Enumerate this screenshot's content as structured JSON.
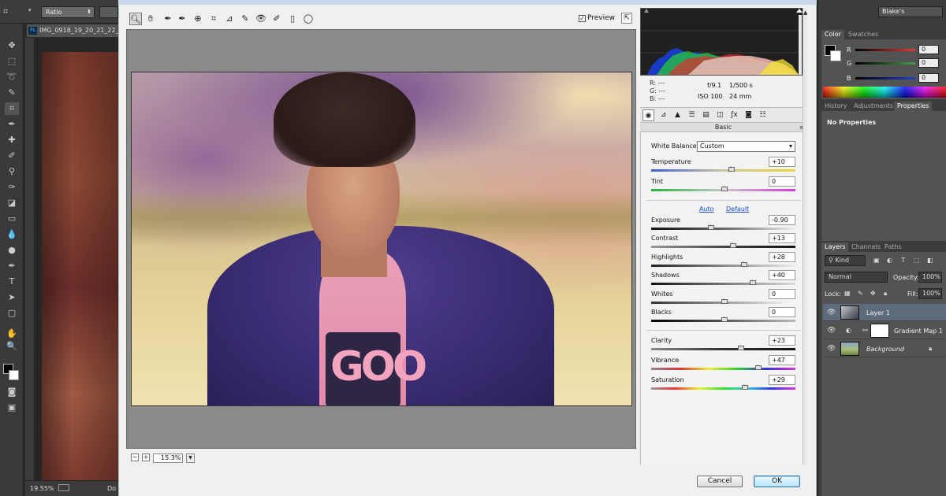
{
  "ps": {
    "options": {
      "ratio_label": "Ratio"
    },
    "doc_tab": "IMG_0918_19_20_21_22_t",
    "status": {
      "zoom": "19.55%",
      "doc_suffix": "Do"
    },
    "workspace": "Blake's"
  },
  "camera_raw": {
    "preview_label": "Preview",
    "preview_checked": true,
    "zoom_value": "15.3%",
    "readout": {
      "r": "R:",
      "g": "G:",
      "b": "B:",
      "dash": "---",
      "aperture": "f/9.1",
      "shutter": "1/500 s",
      "iso": "ISO 100",
      "focal": "24 mm"
    },
    "panel_title": "Basic",
    "white_balance": {
      "label": "White Balance:",
      "value": "Custom"
    },
    "auto_label": "Auto",
    "default_label": "Default",
    "sliders": {
      "temperature": {
        "label": "Temperature",
        "value": "+10",
        "level": 0.55
      },
      "tint": {
        "label": "Tint",
        "value": "0",
        "level": 0.5
      },
      "exposure": {
        "label": "Exposure",
        "value": "-0.90",
        "level": 0.41
      },
      "contrast": {
        "label": "Contrast",
        "value": "+13",
        "level": 0.565
      },
      "highlights": {
        "label": "Highlights",
        "value": "+28",
        "level": 0.64
      },
      "shadows": {
        "label": "Shadows",
        "value": "+40",
        "level": 0.7
      },
      "whites": {
        "label": "Whites",
        "value": "0",
        "level": 0.5
      },
      "blacks": {
        "label": "Blacks",
        "value": "0",
        "level": 0.5
      },
      "clarity": {
        "label": "Clarity",
        "value": "+23",
        "level": 0.615
      },
      "vibrance": {
        "label": "Vibrance",
        "value": "+47",
        "level": 0.735
      },
      "saturation": {
        "label": "Saturation",
        "value": "+29",
        "level": 0.645
      }
    },
    "buttons": {
      "cancel": "Cancel",
      "ok": "OK"
    },
    "photo_text": "GOO"
  },
  "color_panel": {
    "tabs": [
      "Color",
      "Swatches"
    ],
    "channels": [
      {
        "label": "R",
        "value": "0",
        "color": "#e53935"
      },
      {
        "label": "G",
        "value": "0",
        "color": "#43a047"
      },
      {
        "label": "B",
        "value": "0",
        "color": "#1e40c8"
      }
    ]
  },
  "props_panel": {
    "tabs": [
      "History",
      "Adjustments",
      "Properties"
    ],
    "empty_text": "No Properties"
  },
  "layers_panel": {
    "tabs": [
      "Layers",
      "Channels",
      "Paths"
    ],
    "kind_label": "Kind",
    "blend_mode": "Normal",
    "opacity_label": "Opacity:",
    "opacity_value": "100%",
    "lock_label": "Lock:",
    "fill_label": "Fill:",
    "fill_value": "100%",
    "layers": [
      {
        "name": "Layer 1",
        "selected": true
      },
      {
        "name": "Gradient Map 1",
        "selected": false
      },
      {
        "name": "Background",
        "selected": false,
        "locked": true
      }
    ]
  }
}
